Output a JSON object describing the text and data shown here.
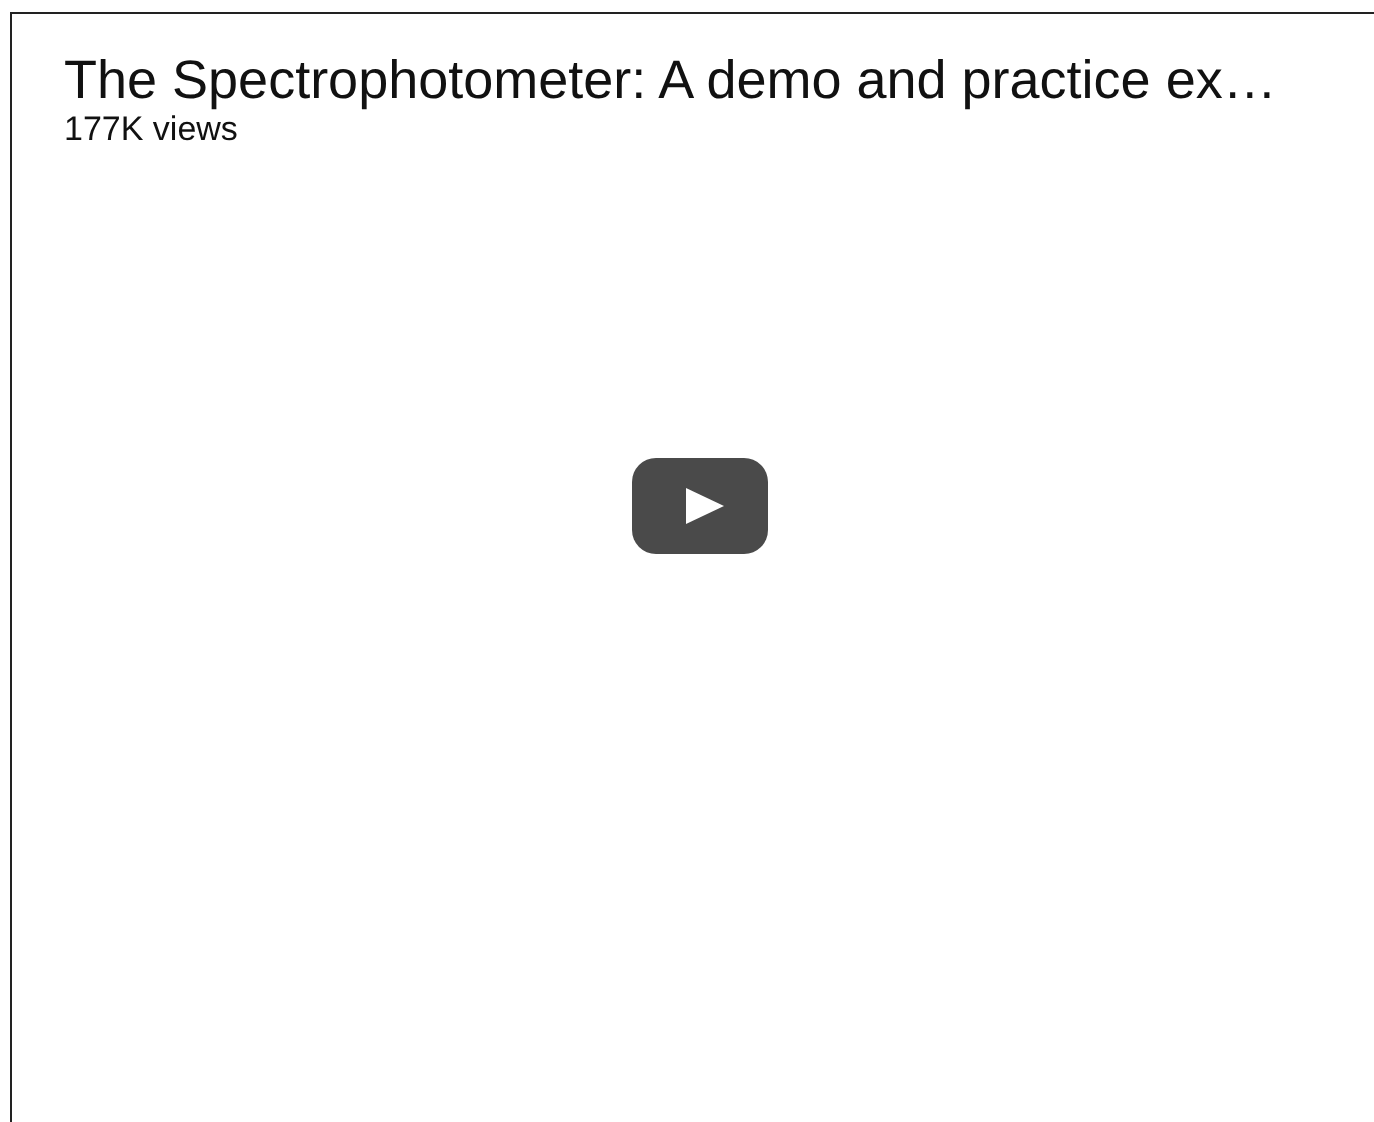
{
  "video": {
    "title": "The Spectrophotometer: A demo and practice ex…",
    "views": "177K views"
  }
}
